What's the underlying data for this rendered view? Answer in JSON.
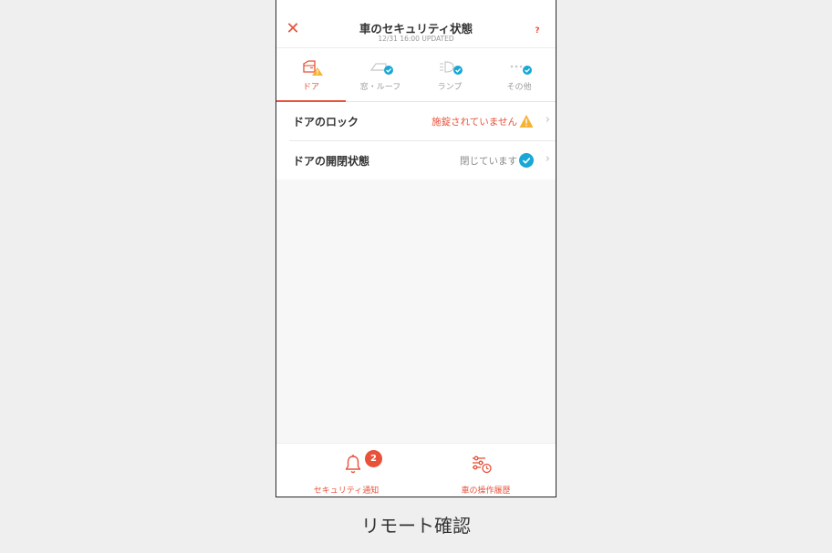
{
  "header": {
    "title": "車のセキュリティ状態",
    "updated": "12/31 16:00 UPDATED",
    "close_icon": "close-icon",
    "help_label": "?"
  },
  "tabs": [
    {
      "label": "ドア",
      "icon": "door-icon",
      "status": "warning",
      "active": true
    },
    {
      "label": "窓・ルーフ",
      "icon": "window-icon",
      "status": "ok",
      "active": false
    },
    {
      "label": "ランプ",
      "icon": "lamp-icon",
      "status": "ok",
      "active": false
    },
    {
      "label": "その他",
      "icon": "more-icon",
      "status": "ok",
      "active": false
    }
  ],
  "rows": [
    {
      "label": "ドアのロック",
      "status": "施錠されていません",
      "status_type": "warning",
      "status_color": "#e8513a"
    },
    {
      "label": "ドアの開閉状態",
      "status": "閉じています",
      "status_type": "ok",
      "status_color": "#8a8a8a"
    }
  ],
  "bottom_nav": [
    {
      "label": "セキュリティ通知",
      "icon": "bell-icon",
      "badge": "2"
    },
    {
      "label": "車の操作履歴",
      "icon": "history-icon"
    }
  ],
  "caption": "リモート確認",
  "colors": {
    "accent": "#e8513a",
    "warning": "#f5b335",
    "ok": "#19a8d6",
    "background": "#efefef"
  }
}
